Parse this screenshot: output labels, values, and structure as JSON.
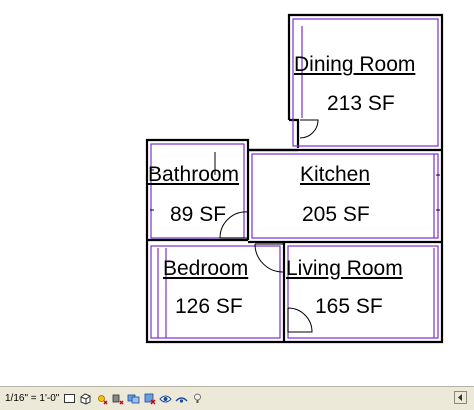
{
  "rooms": [
    {
      "name": "Dining Room",
      "area": "213 SF"
    },
    {
      "name": "Kitchen",
      "area": "205 SF"
    },
    {
      "name": "Bathroom",
      "area": "89 SF"
    },
    {
      "name": "Bedroom",
      "area": "126 SF"
    },
    {
      "name": "Living Room",
      "area": "165 SF"
    }
  ],
  "status_bar": {
    "scale": "1/16\" = 1'-0\"",
    "tools": [
      "detail-level-icon",
      "model-graphics-style-icon",
      "sun-path-icon",
      "shadows-icon",
      "crop-view-icon",
      "show-crop-region-icon",
      "temporary-hide-icon",
      "reveal-hidden-icon",
      "analysis-display-icon"
    ]
  },
  "colors": {
    "wall": "#000000",
    "room_boundary": "#7b2fd6",
    "status_bg": "#ece9d8"
  }
}
